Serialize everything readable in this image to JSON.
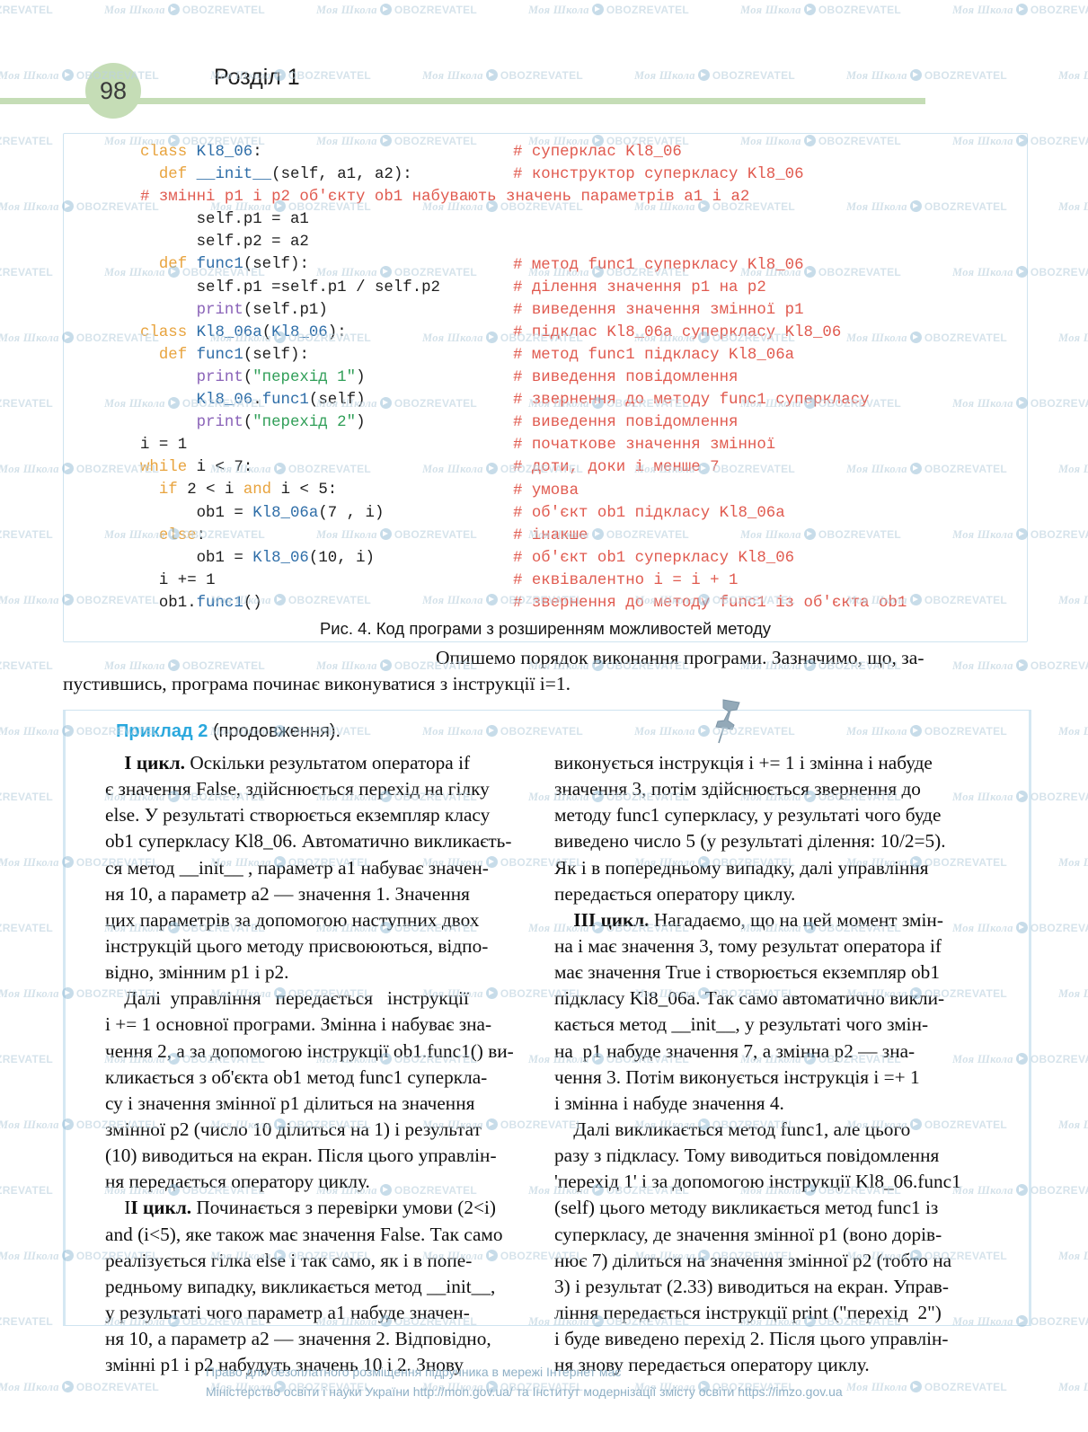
{
  "header": {
    "page_number": "98",
    "chapter_title": "Розділ 1",
    "rule_color": "#c5ddb6",
    "badge_color": "#c5ddb6"
  },
  "code_figure": {
    "caption": "Рис. 4. Код програми з розширенням можливостей методу",
    "colors": {
      "keyword": "#e8a33d",
      "name": "#2f6ea8",
      "plain": "#1d1d1d",
      "function": "#8a63b8",
      "string": "#2f9e57",
      "comment": "#e05a4f"
    },
    "lines": [
      {
        "code": "class Kl8_06:",
        "comment": "# суперклас Kl8_06"
      },
      {
        "code": "  def __init__(self, a1, a2):",
        "comment": "# конструктор суперкласу Kl8_06"
      },
      {
        "code": "# змінні p1 і p2 об'єкту ob1 набувають значень параметрів a1 і a2",
        "comment": ""
      },
      {
        "code": "      self.p1 = a1",
        "comment": ""
      },
      {
        "code": "      self.p2 = a2",
        "comment": ""
      },
      {
        "code": "  def func1(self):",
        "comment": "# метод func1 суперкласу Kl8_06"
      },
      {
        "code": "      self.p1 =self.p1 / self.p2",
        "comment": "# ділення значення p1 на p2"
      },
      {
        "code": "      print(self.p1)",
        "comment": "# виведення значення змінної p1"
      },
      {
        "code": "class Kl8_06a(Kl8_06):",
        "comment": "# підклас Kl8_06a суперкласу Kl8_06"
      },
      {
        "code": "  def func1(self):",
        "comment": "# метод func1 підкласу Kl8_06a"
      },
      {
        "code": "      print(\"перехід 1\")",
        "comment": "# виведення повідомлення"
      },
      {
        "code": "      Kl8_06.func1(self)",
        "comment": "# звернення до методу func1 суперкласу"
      },
      {
        "code": "      print(\"перехід 2\")",
        "comment": "# виведення повідомлення"
      },
      {
        "code": "i = 1",
        "comment": "# початкове значення змінної"
      },
      {
        "code": "while i < 7:",
        "comment": "# доти, доки і менше 7"
      },
      {
        "code": "  if 2 < i and i < 5:",
        "comment": "# умова"
      },
      {
        "code": "      ob1 = Kl8_06a(7 , i)",
        "comment": "# об'єкт ob1 підкласу Kl8_06a"
      },
      {
        "code": "  else:",
        "comment": "# інакше"
      },
      {
        "code": "      ob1 = Kl8_06(10, i)",
        "comment": "# об'єкт ob1 суперкласу Kl8_06"
      },
      {
        "code": "  i += 1",
        "comment": "# еквівалентно i = i + 1"
      },
      {
        "code": "  ob1.func1()",
        "comment": "# звернення до методу func1 із об'єкта ob1"
      }
    ]
  },
  "intro_paragraph": {
    "line1": "Опишемо порядок виконання програми. Зазначимо, що, за-",
    "line2": "пустившись, програма починає виконуватися з інструкції i=1."
  },
  "example_box": {
    "heading_strong": "Приклад 2",
    "heading_rest": " (продовження).",
    "pin_icon": "pushpin-icon",
    "left_column": [
      "    I цикл. Оскільки результатом оператора if",
      "є значення False, здійснюється перехід на гілку",
      "else. У результаті створюється екземпляр класу",
      "ob1 суперкласу Kl8_06. Автоматично викликаєть-",
      "ся метод __init__ , параметр a1 набуває значен-",
      "ня 10, а параметр a2 — значення 1. Значення",
      "цих параметрів за допомогою наступних двох",
      "інструкцій цього методу присвоюються, відпо-",
      "відно, змінним p1 і p2.",
      "    Далі  управління   передається   інструкції",
      "i += 1 основної програми. Змінна i набуває зна-",
      "чення 2, а за допомогою інструкції ob1.func1() ви-",
      "кликається з об'єкта ob1 метод func1 суперкла-",
      "су і значення змінної p1 ділиться на значення",
      "змінної p2 (число 10 ділиться на 1) і результат",
      "(10) виводиться на екран. Після цього управлін-",
      "ня передається оператору циклу.",
      "    II цикл. Починається з перевірки умови (2<i)",
      "and (i<5), яке також має значення False. Так само",
      "реалізується гілка else і так само, як і в попе-",
      "редньому випадку, викликається метод __init__,",
      "у результаті чого параметр a1 набуде значен-",
      "ня 10, а параметр a2 — значення 2. Відповідно,",
      "змінні p1 і p2 набудуть значень 10 і 2. Знову"
    ],
    "right_column": [
      "виконується інструкція i += 1 і змінна i набуде",
      "значення 3, потім здійснюється звернення до",
      "методу func1 суперкласу, у результаті чого буде",
      "виведено число 5 (у результаті ділення: 10/2=5).",
      "Як і в попередньому випадку, далі управління",
      "передається оператору циклу.",
      "    III цикл. Нагадаємо, що на цей момент змін-",
      "на i має значення 3, тому результат оператора if",
      "має значення True і створюється екземпляр ob1",
      "підкласу Kl8_06a. Так само автоматично викли-",
      "кається метод __init__, у результаті чого змін-",
      "на  p1 набуде значення 7, а змінна p2 — зна-",
      "чення 3. Потім виконується інструкція i =+ 1",
      "і змінна i набуде значення 4.",
      "    Далі викликається метод func1, але цього",
      "разу з підкласу. Тому виводиться повідомлення",
      "'перехід 1' і за допомогою інструкції Kl8_06.func1",
      "(self) цього методу викликається метод func1 із",
      "суперкласу, де значення змінної p1 (воно дорів-",
      "нює 7) ділиться на значення змінної p2 (тобто на",
      "3) і результат (2.33) виводиться на екран. Управ-",
      "ління передається інструкції print (\"перехід  2\")",
      "і буде виведено перехід 2. Після цього управлін-",
      "ня знову передається оператору циклу."
    ]
  },
  "footer": {
    "line1": "Право для безоплатного розміщення підручника в мережі Інтернет має",
    "line2": "Міністерство освіти і науки України http://mon.gov.ua/ та Інститут модернізації змісту освіти https://imzo.gov.ua"
  },
  "watermark": {
    "brand_left": "Моя Школа",
    "brand_right": "OBOZREVATEL"
  }
}
